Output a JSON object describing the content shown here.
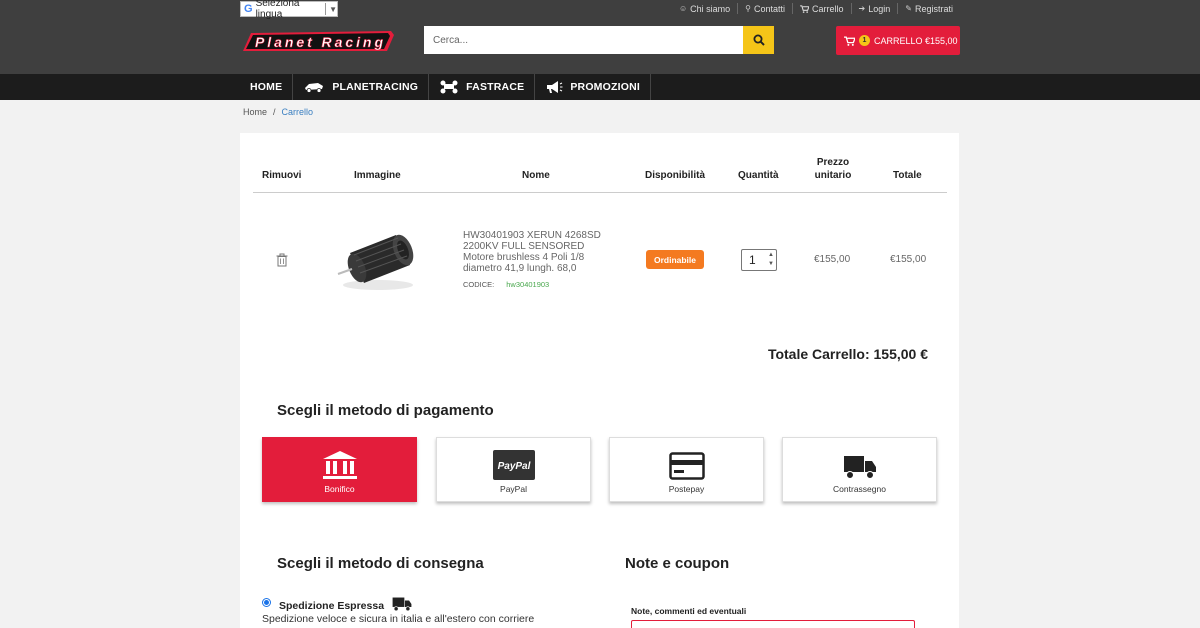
{
  "header": {
    "language_selector": "Seleziona lingua",
    "top_links": [
      {
        "label": "Chi siamo",
        "icon": "smile-icon"
      },
      {
        "label": "Contatti",
        "icon": "map-pin-icon"
      },
      {
        "label": "Carrello",
        "icon": "cart-icon"
      },
      {
        "label": "Login",
        "icon": "login-icon"
      },
      {
        "label": "Registrati",
        "icon": "edit-icon"
      }
    ],
    "logo_text": "Planet Racing",
    "search_placeholder": "Cerca...",
    "cart_count": "1",
    "cart_label": "CARRELLO €155,00"
  },
  "nav": {
    "items": [
      "HOME",
      "PLANETRACING",
      "FASTRACE",
      "PROMOZIONI"
    ]
  },
  "breadcrumb": {
    "home": "Home",
    "separator": "/",
    "current": "Carrello"
  },
  "cart": {
    "headers": {
      "remove": "Rimuovi",
      "image": "Immagine",
      "name": "Nome",
      "availability": "Disponibilità",
      "quantity": "Quantità",
      "unit_price": "Prezzo unitario",
      "total": "Totale"
    },
    "item": {
      "name": "HW30401903 XERUN 4268SD 2200KV FULL SENSORED Motore brushless 4 Poli 1/8 diametro 41,9 lungh. 68,0",
      "code_label": "CODICE:",
      "code": "hw30401903",
      "availability": "Ordinabile",
      "quantity": "1",
      "unit_price": "€155,00",
      "total": "€155,00"
    },
    "cart_total": "Totale Carrello: 155,00 €"
  },
  "payment": {
    "title": "Scegli il metodo di pagamento",
    "methods": [
      {
        "label": "Bonifico",
        "icon": "bank-icon",
        "selected": true
      },
      {
        "label": "PayPal",
        "icon": "paypal-icon",
        "selected": false
      },
      {
        "label": "Postepay",
        "icon": "credit-card-icon",
        "selected": false
      },
      {
        "label": "Contrassegno",
        "icon": "truck-icon",
        "selected": false
      }
    ]
  },
  "delivery": {
    "title": "Scegli il metodo di consegna",
    "option": "Spedizione Espressa",
    "description": "Spedizione veloce e sicura in italia e all'estero con corriere"
  },
  "notes": {
    "title": "Note e coupon",
    "label": "Note, commenti ed eventuali"
  },
  "colors": {
    "header_bg": "#3f3f3f",
    "nav_bg": "#1c1c1c",
    "accent_red": "#e31d3b",
    "search_yellow": "#f5c518",
    "availability_orange": "#f47a20",
    "code_green": "#4aa84e",
    "link_blue": "#3a7fc1"
  }
}
